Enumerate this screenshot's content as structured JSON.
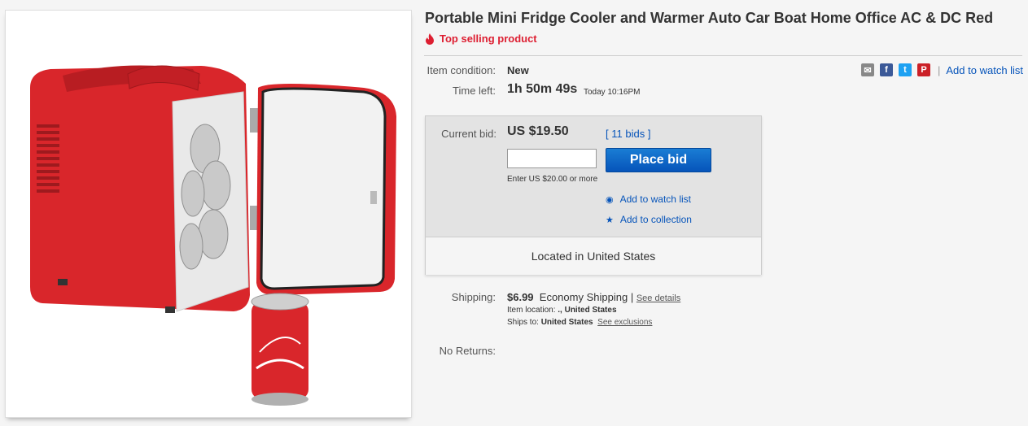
{
  "product": {
    "title": "Portable Mini Fridge Cooler and Warmer Auto Car Boat Home Office AC & DC Red",
    "badge": "Top selling product",
    "image_icon": "mini-fridge-with-cans"
  },
  "details": {
    "condition_label": "Item condition:",
    "condition_value": "New",
    "time_left_label": "Time left:",
    "time_left_value": "1h 50m 49s",
    "end_time": "Today 10:16PM"
  },
  "share": {
    "icons": [
      "email-icon",
      "facebook-icon",
      "twitter-icon",
      "pinterest-icon"
    ],
    "separator": "|",
    "watch_link": "Add to watch list"
  },
  "bid": {
    "current_label": "Current bid:",
    "current_value": "US $19.50",
    "bids_open": "[",
    "bids_count": "11 bids",
    "bids_close": "]",
    "input_value": "",
    "button_label": "Place bid",
    "hint": "Enter US $20.00 or more",
    "watch_link": "Add to watch list",
    "collection_link": "Add to collection",
    "location": "Located in United States"
  },
  "shipping": {
    "label": "Shipping:",
    "cost": "$6.99",
    "method": "Economy Shipping",
    "separator": "|",
    "details_link": "See details",
    "item_location_label": "Item location:",
    "item_location_value": "., United States",
    "ships_to_label": "Ships to:",
    "ships_to_value": "United States",
    "exclusions_link": "See exclusions"
  },
  "returns": {
    "label": "No Returns:"
  },
  "colors": {
    "accent_blue": "#0654ba",
    "badge_red": "#dd1e31",
    "pinterest_red": "#cb2027",
    "facebook_blue": "#3b5998",
    "twitter_blue": "#1da1f2"
  }
}
